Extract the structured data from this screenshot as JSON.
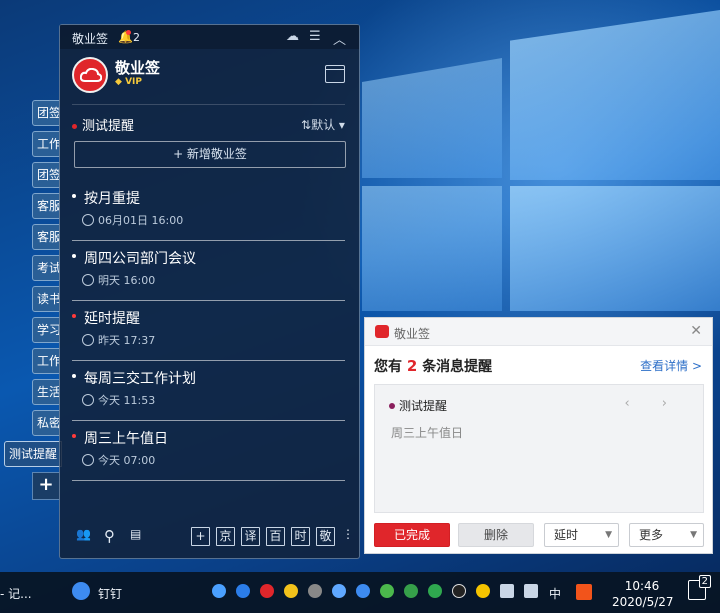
{
  "left_tabs": [
    "团签",
    "工作",
    "团签",
    "客服",
    "客服",
    "考试",
    "读书",
    "学习",
    "工作",
    "生活",
    "私密"
  ],
  "active_tab": "测试提醒",
  "add_tab_label": "+",
  "widget": {
    "title": "敬业签",
    "bell_count": "2",
    "user_name": "敬业签",
    "vip_label": "VIP",
    "category": "测试提醒",
    "sort_label": "默认",
    "add_button": "+ 新增敬业签",
    "items": [
      {
        "title": "按月重提",
        "meta": "06月01日  16:00",
        "bullet": "white"
      },
      {
        "title": "周四公司部门会议",
        "meta": "明天  16:00",
        "bullet": "white"
      },
      {
        "title": "延时提醒",
        "meta": "昨天  17:37",
        "bullet": "red"
      },
      {
        "title": "每周三交工作计划",
        "meta": "今天  11:53",
        "bullet": "white"
      },
      {
        "title": "周三上午值日",
        "meta": "今天  07:00",
        "bullet": "red"
      }
    ],
    "toolbar_buttons": [
      "+",
      "京",
      "译",
      "百",
      "时",
      "敬"
    ]
  },
  "popup": {
    "app_title": "敬业签",
    "headline_prefix": "您有",
    "headline_count": "2",
    "headline_suffix": "条消息提醒",
    "detail_link": "查看详情 >",
    "card_title": "测试提醒",
    "card_body": "周三上午值日",
    "nav": "‹ ›",
    "btn_done": "已完成",
    "btn_delete": "删除",
    "btn_delay": "延时",
    "btn_more": "更多"
  },
  "taskbar": {
    "app_left": "- 记...",
    "app_dingding": "钉钉",
    "ime": "中",
    "time": "10:46",
    "date": "2020/5/27",
    "notif_count": "2"
  },
  "colors": {
    "accent": "#e0262b",
    "link": "#2d6fc8",
    "panel": "#12223a"
  }
}
